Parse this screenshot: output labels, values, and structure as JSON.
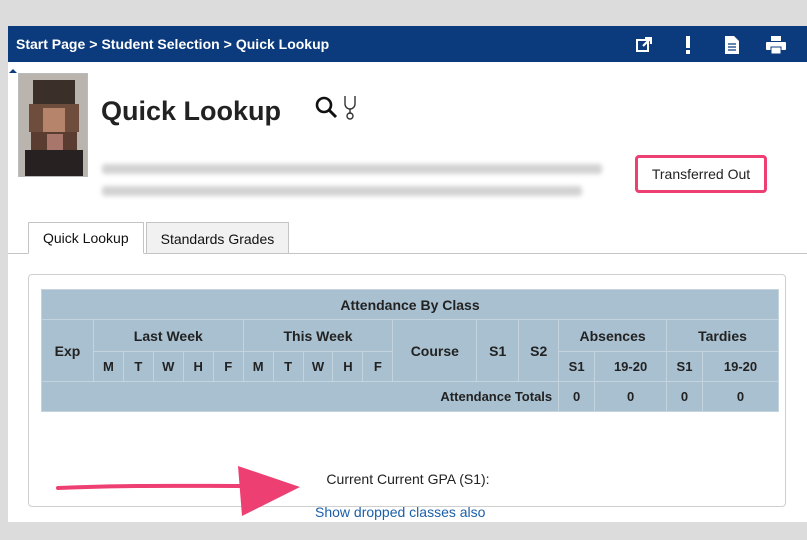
{
  "breadcrumb": [
    "Start Page",
    "Student Selection",
    "Quick Lookup"
  ],
  "breadcrumb_separator": ">",
  "toolbar_icons": [
    "external-link-icon",
    "alert-icon",
    "document-icon",
    "printer-icon"
  ],
  "page_title": "Quick Lookup",
  "title_icons": [
    "magnifier-icon",
    "stethoscope-icon"
  ],
  "status_badge": "Transferred Out",
  "tabs": [
    {
      "label": "Quick Lookup",
      "active": true
    },
    {
      "label": "Standards Grades",
      "active": false
    }
  ],
  "attendance": {
    "title": "Attendance By Class",
    "exp": "Exp",
    "last_week": "Last Week",
    "this_week": "This Week",
    "days": [
      "M",
      "T",
      "W",
      "H",
      "F"
    ],
    "course": "Course",
    "s1": "S1",
    "s2": "S2",
    "absences": "Absences",
    "tardies": "Tardies",
    "absences_cols": [
      "S1",
      "19-20"
    ],
    "tardies_cols": [
      "S1",
      "19-20"
    ],
    "totals_label": "Attendance Totals",
    "totals": [
      "0",
      "0",
      "0",
      "0"
    ]
  },
  "gpa_label": "Current Current GPA (S1):",
  "dropped_link": "Show dropped classes also",
  "colors": {
    "header_bar": "#0c3b7d",
    "table_bg": "#a9c0d0",
    "highlight": "#ee3f72",
    "link": "#1a5fa8"
  }
}
